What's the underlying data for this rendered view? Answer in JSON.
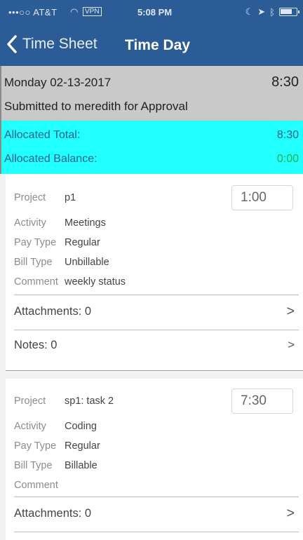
{
  "status_bar": {
    "carrier": "•••○○ AT&T",
    "vpn": "VPN",
    "time": "5:08 PM"
  },
  "nav": {
    "back_label": "Time Sheet",
    "title": "Time Day"
  },
  "day": {
    "date": "Monday 02-13-2017",
    "total": "8:30",
    "status": "Submitted to meredith for Approval"
  },
  "allocated": {
    "total_label": "Allocated Total:",
    "total_value": "8:30",
    "balance_label": "Allocated Balance:",
    "balance_value": "0:00"
  },
  "entries": [
    {
      "hours": "1:00",
      "project_label": "Project",
      "project": "p1",
      "activity_label": "Activity",
      "activity": "Meetings",
      "pay_type_label": "Pay Type",
      "pay_type": "Regular",
      "bill_type_label": "Bill Type",
      "bill_type": "Unbillable",
      "comment_label": "Comment",
      "comment": "weekly status",
      "attachments": "Attachments: 0",
      "notes": "Notes: 0"
    },
    {
      "hours": "7:30",
      "project_label": "Project",
      "project": "sp1: task 2",
      "activity_label": "Activity",
      "activity": "Coding",
      "pay_type_label": "Pay Type",
      "pay_type": "Regular",
      "bill_type_label": "Bill Type",
      "bill_type": "Billable",
      "comment_label": "Comment",
      "comment": "",
      "attachments": "Attachments: 0"
    }
  ],
  "chevron": ">"
}
